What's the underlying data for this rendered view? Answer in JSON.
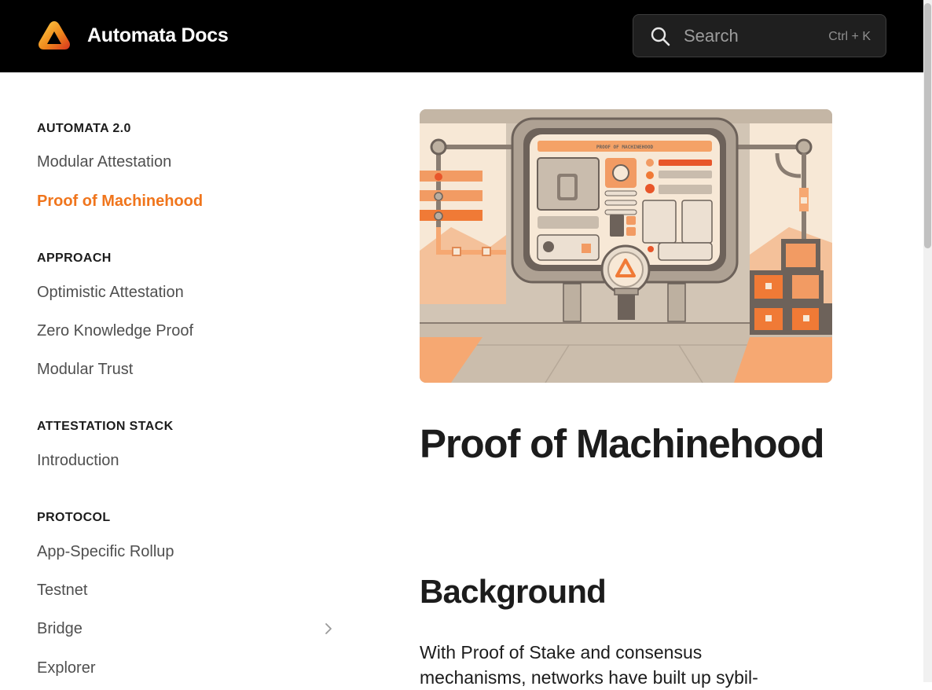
{
  "header": {
    "site_title": "Automata Docs",
    "logo_icon": "automata-triangle-logo",
    "search": {
      "placeholder": "Search",
      "shortcut": "Ctrl + K"
    }
  },
  "sidebar": {
    "sections": [
      {
        "heading": "AUTOMATA 2.0",
        "items": [
          "Modular Attestation",
          "Proof of Machinehood"
        ]
      },
      {
        "heading": "APPROACH",
        "items": [
          "Optimistic Attestation",
          "Zero Knowledge Proof",
          "Modular Trust"
        ]
      },
      {
        "heading": "ATTESTATION STACK",
        "items": [
          "Introduction"
        ]
      },
      {
        "heading": "PROTOCOL",
        "items": [
          "App-Specific Rollup",
          "Testnet",
          "Bridge",
          "Explorer"
        ]
      }
    ],
    "active_item": "Proof of Machinehood"
  },
  "main": {
    "hero_banner_text": "PROOF OF MACHINEHOOD",
    "title": "Proof of Machinehood",
    "section_heading": "Background",
    "paragraph": "With Proof of Stake and consensus mechanisms, networks have built up sybil-"
  },
  "colors": {
    "accent": "#f0751c",
    "header_bg": "#000000",
    "text": "#1c1c1c",
    "nav_text": "#4f4f4f"
  }
}
